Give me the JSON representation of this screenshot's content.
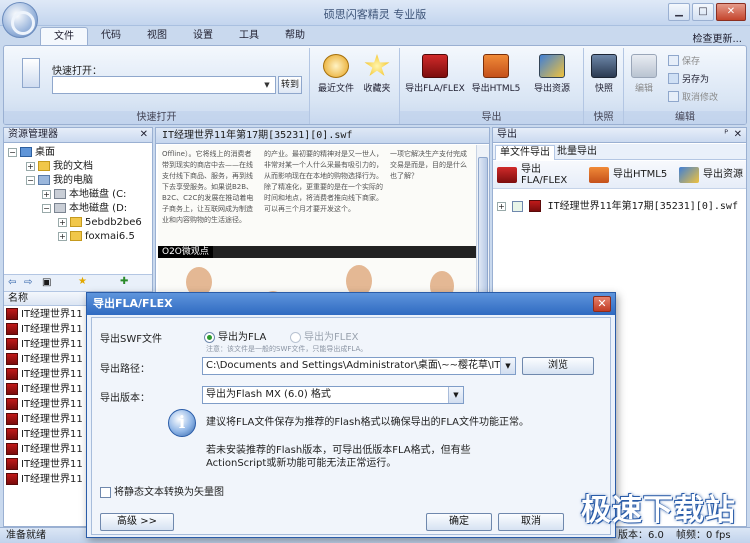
{
  "window": {
    "title": "硕思闪客精灵 专业版"
  },
  "tabs": [
    {
      "label": "文件",
      "active": true
    },
    {
      "label": "代码"
    },
    {
      "label": "视图"
    },
    {
      "label": "设置"
    },
    {
      "label": "工具"
    },
    {
      "label": "帮助"
    }
  ],
  "help_link": "检查更新...",
  "ribbon": {
    "quick_open": {
      "label": "快速打开：",
      "goto": "转到",
      "group": "快速打开"
    },
    "recent": "最近文件",
    "favorites": "收藏夹",
    "export_fla": "导出FLA/FLEX",
    "export_html5": "导出HTML5",
    "export_resources": "导出资源",
    "export_group": "导出",
    "snapshot": "快照",
    "snapshot_group": "快照",
    "edit": "编辑",
    "save": "保存",
    "save_as": "另存为",
    "undo": "取消修改",
    "edit_group": "编辑"
  },
  "left_panel": {
    "title": "资源管理器",
    "tree": [
      {
        "label": "桌面",
        "indent": 0
      },
      {
        "label": "我的文档",
        "indent": 1
      },
      {
        "label": "我的电脑",
        "indent": 1
      },
      {
        "label": "本地磁盘 (C:",
        "indent": 2
      },
      {
        "label": "本地磁盘 (D:",
        "indent": 2
      },
      {
        "label": "5ebdb2be6",
        "indent": 3
      },
      {
        "label": "foxmai6.5",
        "indent": 3
      }
    ],
    "list_header": "名称",
    "files": [
      "IT经理世界11",
      "IT经理世界11",
      "IT经理世界11",
      "IT经理世界11",
      "IT经理世界11",
      "IT经理世界11",
      "IT经理世界11",
      "IT经理世界11",
      "IT经理世界11",
      "IT经理世界11",
      "IT经理世界11",
      "IT经理世界11"
    ]
  },
  "preview": {
    "title": "IT经理世界11年第17期[35231][0].swf",
    "col1": "Offline）。它将线上的消费者带到现实的商店中去——在线支付线下商品、服务，再到线下去享受服务。如果说B2B、B2C、C2C的发展在推动着电子商务上，让互联网成为制造业和内容购物的生活途径。",
    "col2": "的产业。最初要的精神对是又一世人，非常对某一个人什么采最有吸引力的，从而影响现在在本地的购物选择行为。除了精准化，更重要的是在一个实际的时间和地点，将消费者推向线下商家。可以再三个月才要开发这个。",
    "col3": "一项它解决生产支付完成交易是而是，目的是什么也了解？",
    "o2o_label": "O2O微观点"
  },
  "right_panel": {
    "title": "导出",
    "tabs": [
      "单文件导出",
      "批量导出"
    ],
    "buttons": [
      "导出\nFLA/FLEX",
      "导出HTML5",
      "导出资源"
    ],
    "tree_item": "IT经理世界11年第17期[35231][0].swf"
  },
  "status": {
    "left": "准备就绪",
    "version": "版本：6.0",
    "fps": "帧频：0 fps"
  },
  "dialog": {
    "title": "导出FLA/FLEX",
    "swf_label": "导出SWF文件",
    "opt_fla": "导出为FLA",
    "opt_flex": "导出为FLEX",
    "hint": "注意：该文件是一般的SWF文件，只能导出成FLA。",
    "path_label": "导出路径：",
    "path_value": "C:\\Documents and Settings\\Administrator\\桌面\\~~樱花草\\IT经理世",
    "browse": "浏览",
    "version_label": "导出版本：",
    "version_value": "导出为Flash MX (6.0) 格式",
    "info1": "建议将FLA文件保存为推荐的Flash格式以确保导出的FLA文件功能正常。",
    "info2": "若未安装推荐的Flash版本，可导出低版本FLA格式，但有些ActionScript或新功能可能无法正常运行。",
    "checkbox": "将静态文本转换为矢量图",
    "advanced": "高级 >>",
    "ok": "确定",
    "cancel": "取消"
  },
  "watermark": "极速下载站",
  "colors": {
    "accent": "#2f6ac1",
    "chrome": "#c9d9ee",
    "swf_icon": "#b01818"
  }
}
